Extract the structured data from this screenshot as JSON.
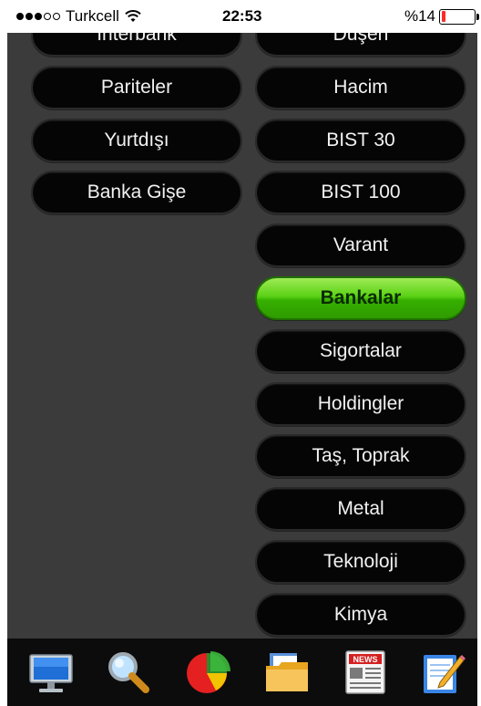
{
  "status_bar": {
    "carrier": "Turkcell",
    "time": "22:53",
    "battery": "%14",
    "battery_level": 0.14,
    "signal_bars_filled": 3,
    "signal_bars_total": 5
  },
  "menu": {
    "left": [
      {
        "label": "İnterbank"
      },
      {
        "label": "Pariteler"
      },
      {
        "label": "Yurtdışı"
      },
      {
        "label": "Banka Gişe"
      }
    ],
    "right": [
      {
        "label": "Düşen"
      },
      {
        "label": "Hacim"
      },
      {
        "label": "BIST 30"
      },
      {
        "label": "BIST 100"
      },
      {
        "label": "Varant"
      },
      {
        "label": "Bankalar",
        "active": true
      },
      {
        "label": "Sigortalar"
      },
      {
        "label": "Holdingler"
      },
      {
        "label": "Taş, Toprak"
      },
      {
        "label": "Metal"
      },
      {
        "label": "Teknoloji"
      },
      {
        "label": "Kimya"
      }
    ]
  },
  "tab_bar": {
    "tabs": [
      {
        "icon": "monitor-icon"
      },
      {
        "icon": "magnifier-icon"
      },
      {
        "icon": "pie-chart-icon"
      },
      {
        "icon": "folder-icon"
      },
      {
        "icon": "news-icon"
      },
      {
        "icon": "notepad-icon"
      }
    ],
    "news_label": "NEWS"
  },
  "colors": {
    "panel_bg": "#3b3b3b",
    "pill_bg": "#050505",
    "active_green": "#4fcc0f",
    "battery_red": "#ff2a2a"
  }
}
